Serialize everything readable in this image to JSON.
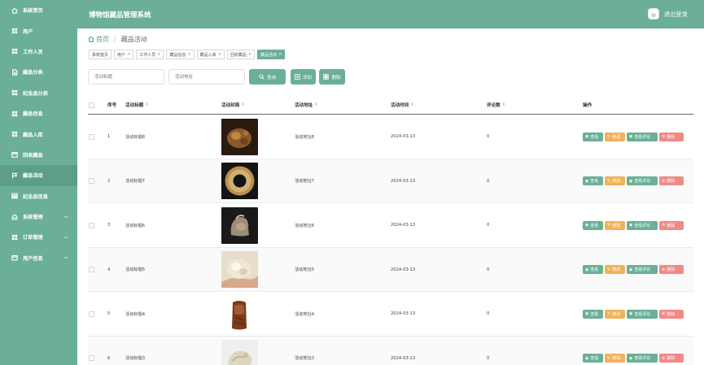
{
  "app": {
    "title": "博物馆藏品管理系统",
    "logout_label": "退出登录"
  },
  "sidebar": {
    "items": [
      {
        "label": "系统首页",
        "icon": "home-icon",
        "chevron": false
      },
      {
        "label": "用户",
        "icon": "grid-icon",
        "chevron": false
      },
      {
        "label": "工作人员",
        "icon": "grid-icon",
        "chevron": false
      },
      {
        "label": "藏品分类",
        "icon": "document-icon",
        "chevron": false
      },
      {
        "label": "纪念品分类",
        "icon": "grid-icon",
        "chevron": false
      },
      {
        "label": "藏品信息",
        "icon": "grid-icon",
        "chevron": false
      },
      {
        "label": "藏品入库",
        "icon": "grid-icon",
        "chevron": false
      },
      {
        "label": "回收藏品",
        "icon": "calendar-icon",
        "chevron": false
      },
      {
        "label": "藏品活动",
        "icon": "flag-icon",
        "chevron": false
      },
      {
        "label": "纪念品信息",
        "icon": "table-icon",
        "chevron": false
      },
      {
        "label": "系统管理",
        "icon": "gear-icon",
        "chevron": true
      },
      {
        "label": "订单管理",
        "icon": "grid-icon",
        "chevron": true
      },
      {
        "label": "用户信息",
        "icon": "user-card-icon",
        "chevron": true
      }
    ],
    "active_index": 8
  },
  "breadcrumb": {
    "home": "首页",
    "separator": "/",
    "current": "藏品活动"
  },
  "tags": [
    {
      "label": "系统首页",
      "closable": false
    },
    {
      "label": "用户",
      "closable": true
    },
    {
      "label": "工作人员",
      "closable": true
    },
    {
      "label": "藏品信息",
      "closable": true
    },
    {
      "label": "藏品入库",
      "closable": true
    },
    {
      "label": "回收藏品",
      "closable": true
    },
    {
      "label": "藏品活动",
      "closable": true,
      "active": true
    }
  ],
  "toolbar": {
    "title_placeholder": "活动标题",
    "address_placeholder": "活动地址",
    "search_label": "查询",
    "add_label": "添加",
    "delete_label": "删除"
  },
  "table": {
    "headers": {
      "index": "序号",
      "title": "活动标题",
      "cover": "活动封面",
      "address": "活动地址",
      "time": "活动时间",
      "comments": "评论数",
      "actions": "操作"
    },
    "action_labels": {
      "view": "查看",
      "edit": "修改",
      "comments": "查看评论",
      "delete": "删除"
    },
    "rows": [
      {
        "index": "1",
        "title": "活动标题8",
        "address": "活动地址8",
        "time": "2024-03-13",
        "comments": "0",
        "image": "dark-brown-carving"
      },
      {
        "index": "2",
        "title": "活动标题7",
        "address": "活动地址7",
        "time": "2024-03-13",
        "comments": "0",
        "image": "jade-ring"
      },
      {
        "index": "3",
        "title": "活动标题6",
        "address": "活动地址6",
        "time": "2024-03-13",
        "comments": "0",
        "image": "stone-animal"
      },
      {
        "index": "4",
        "title": "活动标题5",
        "address": "活动地址5",
        "time": "2024-03-13",
        "comments": "0",
        "image": "white-jade-in-hand"
      },
      {
        "index": "5",
        "title": "活动标题4",
        "address": "活动地址4",
        "time": "2024-03-13",
        "comments": "0",
        "image": "brown-seal"
      },
      {
        "index": "6",
        "title": "活动标题3",
        "address": "活动地址3",
        "time": "2024-03-13",
        "comments": "0",
        "image": "white-jade-carving"
      }
    ]
  },
  "colors": {
    "primary": "#6aaf96",
    "warning": "#f0b25c",
    "danger": "#f08a86"
  }
}
